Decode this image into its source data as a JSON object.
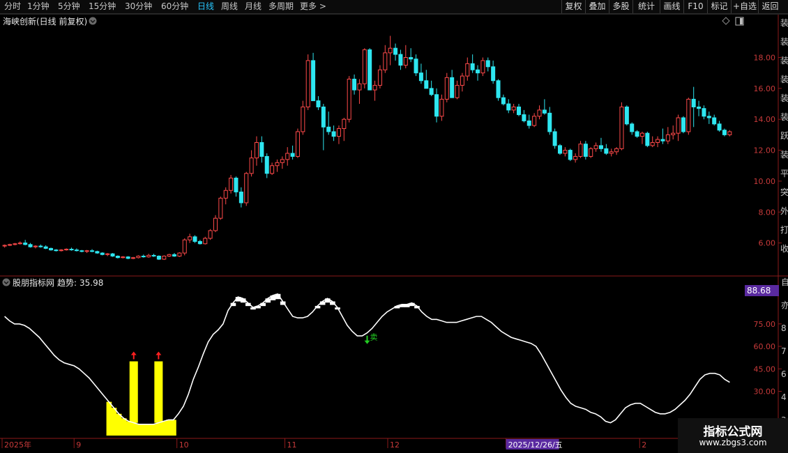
{
  "toolbar": {
    "timeframes": [
      "分时",
      "1分钟",
      "5分钟",
      "15分钟",
      "30分钟",
      "60分钟",
      "日线",
      "周线",
      "月线",
      "多周期",
      "更多 >"
    ],
    "active_timeframe": "日线",
    "buttons": [
      "复权",
      "叠加",
      "多股",
      "统计",
      "画线",
      "F10",
      "标记",
      "+自选",
      "返回"
    ]
  },
  "main_panel": {
    "title": "海峡创新(日线 前复权)"
  },
  "indicator_panel": {
    "name": "股朋指标网",
    "trend_label": "趋势:",
    "trend_value": "35.98",
    "current_value_box": "88.68",
    "buy_marker": "卖"
  },
  "right_edge_glyphs": [
    "装",
    "装",
    "装",
    "装",
    "装",
    "装",
    "跃",
    "装",
    "平",
    "突",
    "外",
    "打",
    "收"
  ],
  "indicator_right_glyphs": [
    "自",
    "亦",
    "8",
    "7",
    "6",
    "4",
    "3"
  ],
  "watermark": {
    "title": "指标公式网",
    "url": "www.zbgs3.com"
  },
  "colors": {
    "up": "#ff4a4a",
    "down": "#2ee6f0",
    "grid": "#8b1a1a",
    "axis_text": "#c83a3a",
    "date_text": "#c83a3a",
    "line": "#ffffff",
    "signal": "#ffff00",
    "arrow_up": "#ff2020",
    "arrow_down": "#22cc22"
  },
  "chart_data": [
    {
      "type": "candlestick",
      "title": "海峡创新(日线 前复权)",
      "y_ticks": [
        "6.00",
        "8.00",
        "10.00",
        "12.00",
        "14.00",
        "16.00",
        "18.00"
      ],
      "ylim": [
        4.0,
        19.6
      ],
      "x_labels": [
        "2025年",
        "9",
        "10",
        "11",
        "12",
        "2025/12/26/五",
        "2"
      ],
      "highlight_date": "2025/12/26/五",
      "candles": [
        [
          5.8,
          5.9,
          5.7,
          5.85
        ],
        [
          5.85,
          5.95,
          5.8,
          5.9
        ],
        [
          5.9,
          6.0,
          5.85,
          5.95
        ],
        [
          5.95,
          6.1,
          5.9,
          6.0
        ],
        [
          6.0,
          6.2,
          5.85,
          5.9
        ],
        [
          5.9,
          6.0,
          5.7,
          5.75
        ],
        [
          5.75,
          5.85,
          5.65,
          5.8
        ],
        [
          5.8,
          5.9,
          5.7,
          5.75
        ],
        [
          5.75,
          5.85,
          5.6,
          5.65
        ],
        [
          5.65,
          5.7,
          5.5,
          5.55
        ],
        [
          5.55,
          5.6,
          5.45,
          5.5
        ],
        [
          5.5,
          5.6,
          5.45,
          5.55
        ],
        [
          5.55,
          5.65,
          5.5,
          5.6
        ],
        [
          5.6,
          5.7,
          5.5,
          5.55
        ],
        [
          5.55,
          5.65,
          5.45,
          5.5
        ],
        [
          5.5,
          5.55,
          5.4,
          5.45
        ],
        [
          5.45,
          5.55,
          5.35,
          5.5
        ],
        [
          5.5,
          5.6,
          5.4,
          5.45
        ],
        [
          5.45,
          5.5,
          5.3,
          5.35
        ],
        [
          5.35,
          5.4,
          5.2,
          5.25
        ],
        [
          5.25,
          5.35,
          5.15,
          5.3
        ],
        [
          5.3,
          5.35,
          5.1,
          5.15
        ],
        [
          5.15,
          5.2,
          5.0,
          5.05
        ],
        [
          5.05,
          5.15,
          5.0,
          5.1
        ],
        [
          5.1,
          5.15,
          4.95,
          5.0
        ],
        [
          5.0,
          5.1,
          4.95,
          5.05
        ],
        [
          5.05,
          5.2,
          5.0,
          5.15
        ],
        [
          5.15,
          5.25,
          5.05,
          5.1
        ],
        [
          5.1,
          5.3,
          5.05,
          5.2
        ],
        [
          5.2,
          5.3,
          5.1,
          5.15
        ],
        [
          5.15,
          5.2,
          4.9,
          4.95
        ],
        [
          4.95,
          5.2,
          4.9,
          5.15
        ],
        [
          5.15,
          5.3,
          5.1,
          5.25
        ],
        [
          5.25,
          5.35,
          5.1,
          5.15
        ],
        [
          5.15,
          5.4,
          5.1,
          5.35
        ],
        [
          5.35,
          6.3,
          5.2,
          6.2
        ],
        [
          6.2,
          6.6,
          6.0,
          6.4
        ],
        [
          6.4,
          6.5,
          6.0,
          6.1
        ],
        [
          6.1,
          6.2,
          5.9,
          5.95
        ],
        [
          5.95,
          6.4,
          5.9,
          6.3
        ],
        [
          6.3,
          6.9,
          6.2,
          6.8
        ],
        [
          6.8,
          7.8,
          6.7,
          7.6
        ],
        [
          7.6,
          9.0,
          7.5,
          8.9
        ],
        [
          8.9,
          9.6,
          8.5,
          9.4
        ],
        [
          9.4,
          10.4,
          9.2,
          10.2
        ],
        [
          10.2,
          10.3,
          9.0,
          9.3
        ],
        [
          9.3,
          9.6,
          8.3,
          8.6
        ],
        [
          8.6,
          10.6,
          8.4,
          10.5
        ],
        [
          10.5,
          12.0,
          10.3,
          11.5
        ],
        [
          11.5,
          12.9,
          11.0,
          12.5
        ],
        [
          12.5,
          12.9,
          11.2,
          11.6
        ],
        [
          11.6,
          11.8,
          10.2,
          10.5
        ],
        [
          10.5,
          11.2,
          10.4,
          11.0
        ],
        [
          11.0,
          11.4,
          10.6,
          11.2
        ],
        [
          11.2,
          11.6,
          10.8,
          11.4
        ],
        [
          11.4,
          12.2,
          11.0,
          11.8
        ],
        [
          11.8,
          12.3,
          11.4,
          11.6
        ],
        [
          11.6,
          13.4,
          11.5,
          13.2
        ],
        [
          13.2,
          15.2,
          13.0,
          14.8
        ],
        [
          14.8,
          18.2,
          14.6,
          17.8
        ],
        [
          17.8,
          18.3,
          15.6,
          15.2
        ],
        [
          15.2,
          15.5,
          14.6,
          14.8
        ],
        [
          14.8,
          15.0,
          12.0,
          13.5
        ],
        [
          13.5,
          14.5,
          13.0,
          13.2
        ],
        [
          13.2,
          13.6,
          12.6,
          12.9
        ],
        [
          12.9,
          13.6,
          12.4,
          13.4
        ],
        [
          13.4,
          14.1,
          12.6,
          14.0
        ],
        [
          14.0,
          16.8,
          13.8,
          16.6
        ],
        [
          16.6,
          16.9,
          15.6,
          15.9
        ],
        [
          15.9,
          16.6,
          15.0,
          16.3
        ],
        [
          16.3,
          18.6,
          16.0,
          18.5
        ],
        [
          18.5,
          18.6,
          16.0,
          15.9
        ],
        [
          15.9,
          16.5,
          15.2,
          16.2
        ],
        [
          16.2,
          17.5,
          16.0,
          17.2
        ],
        [
          17.2,
          18.8,
          17.0,
          18.3
        ],
        [
          18.3,
          19.4,
          17.5,
          18.6
        ],
        [
          18.6,
          18.9,
          17.8,
          18.2
        ],
        [
          18.2,
          18.5,
          17.2,
          17.5
        ],
        [
          17.5,
          18.8,
          17.3,
          18.0
        ],
        [
          18.0,
          18.6,
          17.7,
          17.9
        ],
        [
          17.9,
          18.2,
          16.8,
          17.0
        ],
        [
          17.0,
          17.6,
          16.3,
          16.5
        ],
        [
          16.5,
          17.2,
          16.3,
          16.0
        ],
        [
          16.0,
          16.5,
          15.5,
          15.6
        ],
        [
          15.6,
          16.0,
          13.8,
          14.2
        ],
        [
          14.2,
          15.6,
          13.9,
          15.3
        ],
        [
          15.3,
          17.0,
          15.1,
          16.7
        ],
        [
          16.7,
          17.2,
          16.1,
          15.4
        ],
        [
          15.4,
          16.5,
          15.3,
          16.2
        ],
        [
          16.2,
          17.0,
          15.8,
          16.8
        ],
        [
          16.8,
          18.0,
          16.5,
          17.6
        ],
        [
          17.6,
          18.2,
          17.0,
          17.2
        ],
        [
          17.2,
          17.5,
          16.5,
          17.0
        ],
        [
          17.0,
          18.0,
          16.8,
          17.8
        ],
        [
          17.8,
          18.0,
          17.1,
          17.4
        ],
        [
          17.4,
          17.8,
          16.3,
          16.5
        ],
        [
          16.5,
          16.6,
          15.2,
          15.4
        ],
        [
          15.4,
          15.6,
          14.9,
          15.0
        ],
        [
          15.0,
          15.3,
          14.4,
          14.6
        ],
        [
          14.6,
          15.0,
          14.4,
          14.8
        ],
        [
          14.8,
          15.0,
          14.2,
          14.3
        ],
        [
          14.3,
          14.6,
          13.8,
          13.9
        ],
        [
          13.9,
          14.3,
          13.4,
          13.6
        ],
        [
          13.6,
          14.4,
          13.5,
          14.2
        ],
        [
          14.2,
          14.9,
          14.0,
          14.6
        ],
        [
          14.6,
          15.3,
          14.3,
          14.4
        ],
        [
          14.4,
          14.8,
          13.0,
          13.2
        ],
        [
          13.2,
          13.4,
          12.1,
          12.3
        ],
        [
          12.3,
          12.4,
          11.7,
          11.8
        ],
        [
          11.8,
          12.2,
          11.6,
          12.0
        ],
        [
          12.0,
          12.1,
          11.3,
          11.4
        ],
        [
          11.4,
          11.8,
          11.2,
          11.6
        ],
        [
          11.6,
          12.6,
          11.5,
          12.4
        ],
        [
          12.4,
          12.6,
          11.4,
          11.6
        ],
        [
          11.6,
          12.2,
          11.5,
          12.1
        ],
        [
          12.1,
          12.5,
          11.9,
          12.3
        ],
        [
          12.3,
          12.8,
          11.9,
          12.1
        ],
        [
          12.1,
          12.4,
          11.7,
          11.8
        ],
        [
          11.8,
          12.1,
          11.6,
          11.9
        ],
        [
          11.9,
          12.2,
          11.7,
          12.1
        ],
        [
          12.1,
          15.1,
          12.0,
          14.8
        ],
        [
          14.8,
          14.9,
          13.6,
          13.7
        ],
        [
          13.7,
          13.8,
          13.0,
          13.2
        ],
        [
          13.2,
          13.3,
          12.8,
          12.9
        ],
        [
          12.9,
          13.2,
          12.4,
          13.1
        ],
        [
          13.1,
          13.2,
          12.2,
          12.3
        ],
        [
          12.3,
          12.9,
          12.2,
          12.5
        ],
        [
          12.5,
          12.9,
          12.2,
          12.7
        ],
        [
          12.7,
          13.4,
          12.4,
          12.6
        ],
        [
          12.6,
          13.5,
          12.4,
          13.0
        ],
        [
          13.0,
          13.6,
          12.7,
          13.1
        ],
        [
          13.1,
          14.3,
          12.6,
          14.1
        ],
        [
          14.1,
          14.2,
          13.1,
          13.2
        ],
        [
          13.2,
          15.4,
          13.0,
          15.3
        ],
        [
          15.3,
          16.1,
          13.5,
          14.8
        ],
        [
          14.8,
          15.2,
          14.2,
          14.7
        ],
        [
          14.7,
          14.9,
          14.0,
          14.2
        ],
        [
          14.2,
          14.5,
          13.7,
          14.1
        ],
        [
          14.1,
          14.3,
          13.6,
          13.7
        ],
        [
          13.7,
          13.9,
          13.2,
          13.3
        ],
        [
          13.3,
          13.4,
          12.9,
          13.0
        ],
        [
          13.0,
          13.3,
          12.9,
          13.2
        ]
      ]
    },
    {
      "type": "line",
      "title": "股朋指标网 趋势",
      "y_ticks": [
        "30.00",
        "45.00",
        "60.00",
        "75.00"
      ],
      "ylim": [
        0,
        100
      ],
      "series": [
        {
          "name": "趋势",
          "values": [
            80,
            77,
            75,
            75,
            74,
            72,
            69,
            66,
            62,
            58,
            54,
            51,
            49,
            48,
            47,
            45,
            42,
            39,
            35,
            31,
            27,
            23,
            19,
            15,
            12,
            10,
            9,
            8,
            8,
            8,
            8,
            9,
            10,
            11,
            11,
            15,
            20,
            28,
            38,
            46,
            55,
            63,
            68,
            71,
            75,
            84,
            89,
            93,
            92,
            89,
            86,
            87,
            89,
            92,
            94,
            95,
            90,
            85,
            80,
            79,
            79,
            80,
            83,
            87,
            90,
            92,
            90,
            86,
            80,
            74,
            70,
            67,
            67,
            69,
            72,
            76,
            80,
            83,
            85,
            87,
            88,
            88,
            89,
            87,
            83,
            80,
            78,
            78,
            77,
            76,
            76,
            76,
            77,
            78,
            79,
            80,
            80,
            78,
            76,
            73,
            70,
            68,
            66,
            65,
            64,
            63,
            62,
            60,
            55,
            49,
            43,
            37,
            31,
            26,
            22,
            20,
            19,
            18,
            16,
            15,
            13,
            10,
            9,
            11,
            15,
            19,
            21,
            22,
            22,
            20,
            18,
            16,
            15,
            15,
            16,
            18,
            21,
            24,
            28,
            33,
            38,
            41,
            42,
            42,
            41,
            38,
            36
          ]
        }
      ],
      "signal_bars": [
        {
          "index": 26,
          "value": 50
        },
        {
          "index": 31,
          "value": 50
        }
      ],
      "buy_arrows": [
        26,
        31
      ],
      "sell_marker_index": 73
    }
  ]
}
